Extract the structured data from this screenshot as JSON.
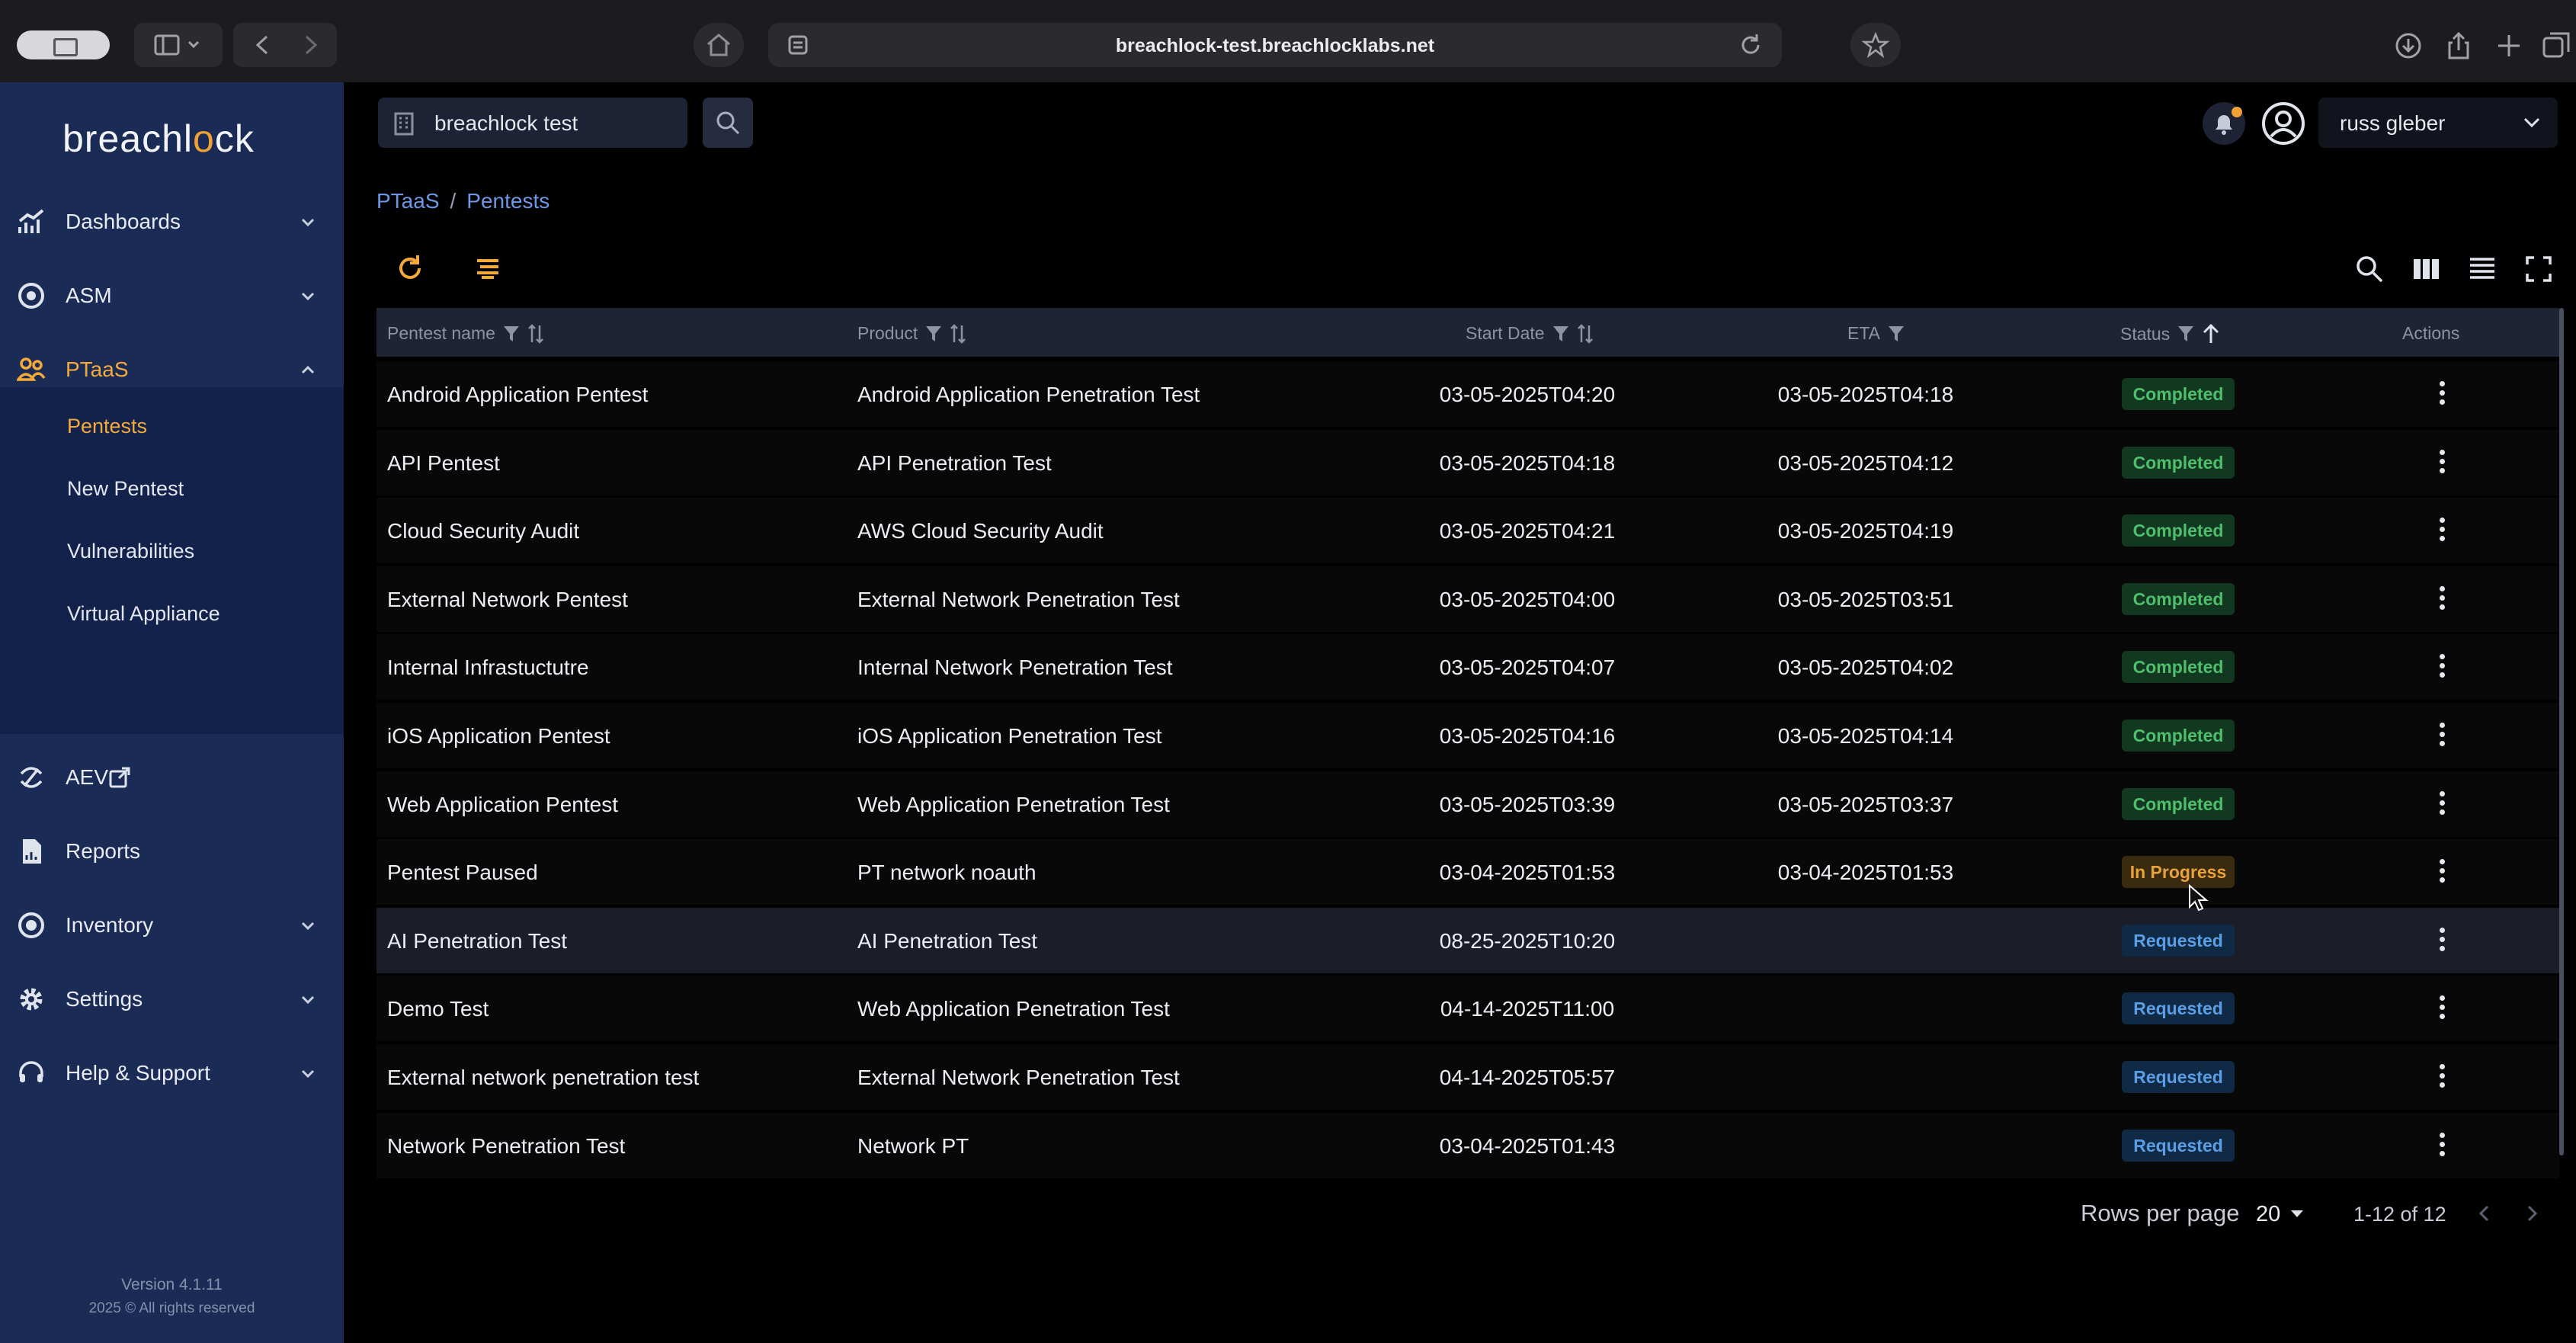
{
  "browser": {
    "url": "breachlock-test.breachlocklabs.net"
  },
  "sidebar": {
    "logo_prefix": "breachl",
    "logo_mark": "o",
    "logo_suffix": "ck",
    "items": [
      {
        "label": "Dashboards",
        "icon": "chart-icon"
      },
      {
        "label": "ASM",
        "icon": "radar-icon"
      },
      {
        "label": "PTaaS",
        "icon": "users-icon"
      },
      {
        "label": "AEV",
        "icon": "orbit-icon"
      },
      {
        "label": "Reports",
        "icon": "report-icon"
      },
      {
        "label": "Inventory",
        "icon": "inventory-icon"
      },
      {
        "label": "Settings",
        "icon": "gear-icon"
      },
      {
        "label": "Help & Support",
        "icon": "headset-icon"
      }
    ],
    "subitems": [
      "Pentests",
      "New Pentest",
      "Vulnerabilities",
      "Virtual Appliance"
    ],
    "version": "Version 4.1.11",
    "copyright": "2025 © All rights reserved"
  },
  "header": {
    "tenant": "breachlock test",
    "user": "russ gleber"
  },
  "breadcrumb": {
    "root": "PTaaS",
    "sep": "/",
    "current": "Pentests"
  },
  "table": {
    "columns": {
      "name": "Pentest name",
      "product": "Product",
      "start": "Start Date",
      "eta": "ETA",
      "status": "Status",
      "actions": "Actions"
    },
    "rows": [
      {
        "name": "Android Application Pentest",
        "product": "Android Application Penetration Test",
        "start": "03-05-2025T04:20",
        "eta": "03-05-2025T04:18",
        "status": "Completed"
      },
      {
        "name": "API Pentest",
        "product": "API Penetration Test",
        "start": "03-05-2025T04:18",
        "eta": "03-05-2025T04:12",
        "status": "Completed"
      },
      {
        "name": "Cloud Security Audit",
        "product": "AWS Cloud Security Audit",
        "start": "03-05-2025T04:21",
        "eta": "03-05-2025T04:19",
        "status": "Completed"
      },
      {
        "name": "External Network Pentest",
        "product": "External Network Penetration Test",
        "start": "03-05-2025T04:00",
        "eta": "03-05-2025T03:51",
        "status": "Completed"
      },
      {
        "name": "Internal Infrastuctutre",
        "product": "Internal Network Penetration Test",
        "start": "03-05-2025T04:07",
        "eta": "03-05-2025T04:02",
        "status": "Completed"
      },
      {
        "name": "iOS Application Pentest",
        "product": "iOS Application Penetration Test",
        "start": "03-05-2025T04:16",
        "eta": "03-05-2025T04:14",
        "status": "Completed"
      },
      {
        "name": "Web Application Pentest",
        "product": "Web Application Penetration Test",
        "start": "03-05-2025T03:39",
        "eta": "03-05-2025T03:37",
        "status": "Completed"
      },
      {
        "name": "Pentest Paused",
        "product": "PT network noauth",
        "start": "03-04-2025T01:53",
        "eta": "03-04-2025T01:53",
        "status": "In Progress"
      },
      {
        "name": "AI Penetration Test",
        "product": "AI Penetration Test",
        "start": "08-25-2025T10:20",
        "eta": "",
        "status": "Requested"
      },
      {
        "name": "Demo Test",
        "product": "Web Application Penetration Test",
        "start": "04-14-2025T11:00",
        "eta": "",
        "status": "Requested"
      },
      {
        "name": "External network penetration test",
        "product": "External Network Penetration Test",
        "start": "04-14-2025T05:57",
        "eta": "",
        "status": "Requested"
      },
      {
        "name": "Network Penetration Test",
        "product": "Network PT",
        "start": "03-04-2025T01:43",
        "eta": "",
        "status": "Requested"
      }
    ]
  },
  "pagination": {
    "rows_per_page_label": "Rows per page",
    "rows_per_page": "20",
    "range": "1-12 of 12"
  },
  "colors": {
    "accent": "#f4a93a",
    "sidebar_bg": "#1a2c56",
    "link": "#6e97e6",
    "completed": "#4fbf6c",
    "in_progress": "#e9a23b",
    "requested": "#5a9fe6"
  }
}
